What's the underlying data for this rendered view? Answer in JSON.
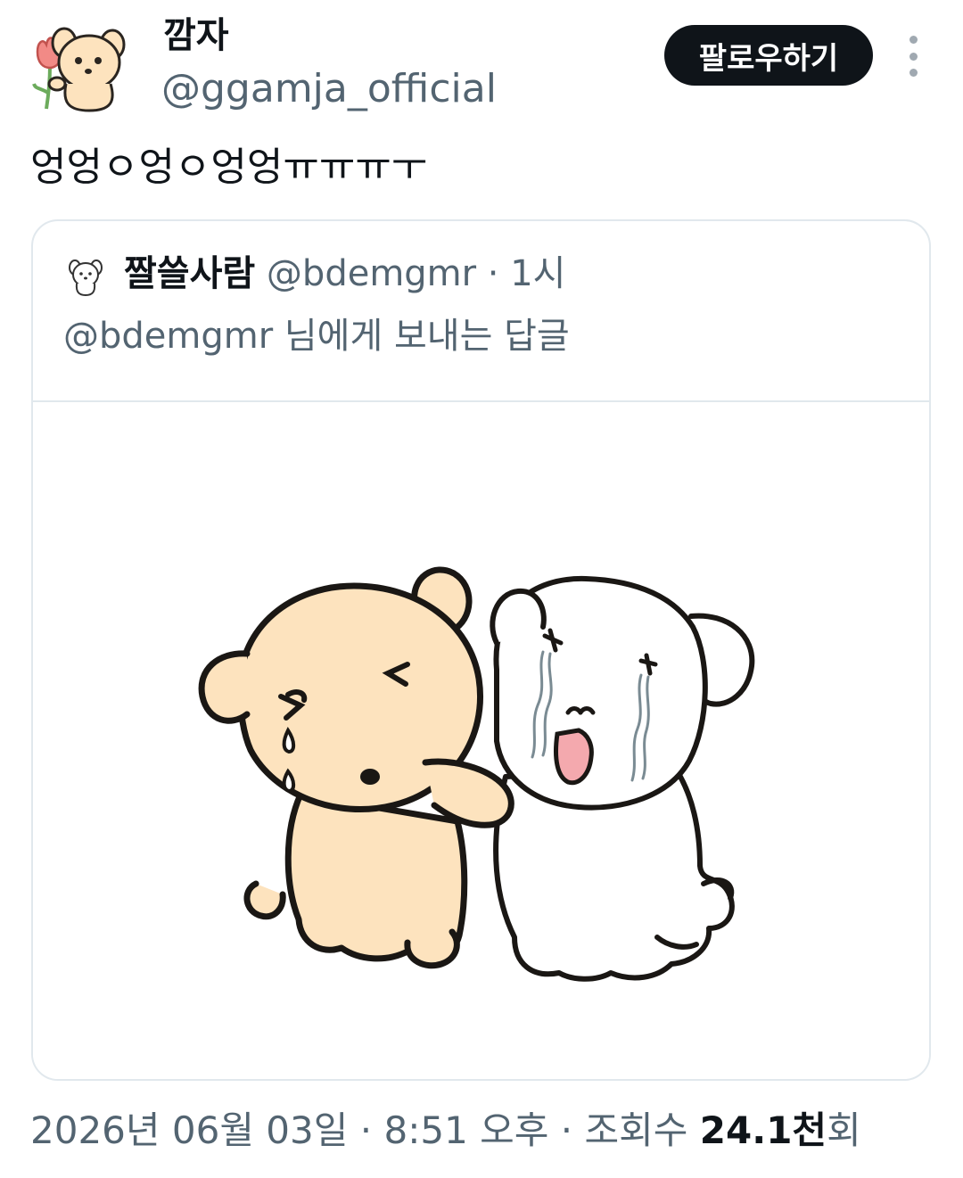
{
  "author": {
    "display_name": "깜자",
    "handle": "@ggamja_official"
  },
  "actions": {
    "follow_label": "팔로우하기"
  },
  "tweet": {
    "text": "엉엉ㅇ엉ㅇ엉엉ㅠㅠㅠㅜ"
  },
  "quoted": {
    "display_name": "짤쓸사람",
    "handle": "@bdemgmr",
    "separator": "·",
    "time": "1시",
    "reply_to": "@bdemgmr 님에게 보내는 답글"
  },
  "footer": {
    "date": "2026년 06월 03일",
    "separator": "·",
    "time": "8:51 오후",
    "views_label": "조회수",
    "views_count": "24.1천",
    "views_unit": "회"
  },
  "colors": {
    "text_primary": "#0f1419",
    "text_secondary": "#536471",
    "border": "#e1e8ed",
    "follow_bg": "#0f1419",
    "puppy_tan": "#fde3be",
    "puppy_white": "#ffffff",
    "tear_blue": "#7fa3b5",
    "mouth_pink": "#f4a9ae"
  },
  "icons": {
    "more": "more-vertical-icon"
  }
}
